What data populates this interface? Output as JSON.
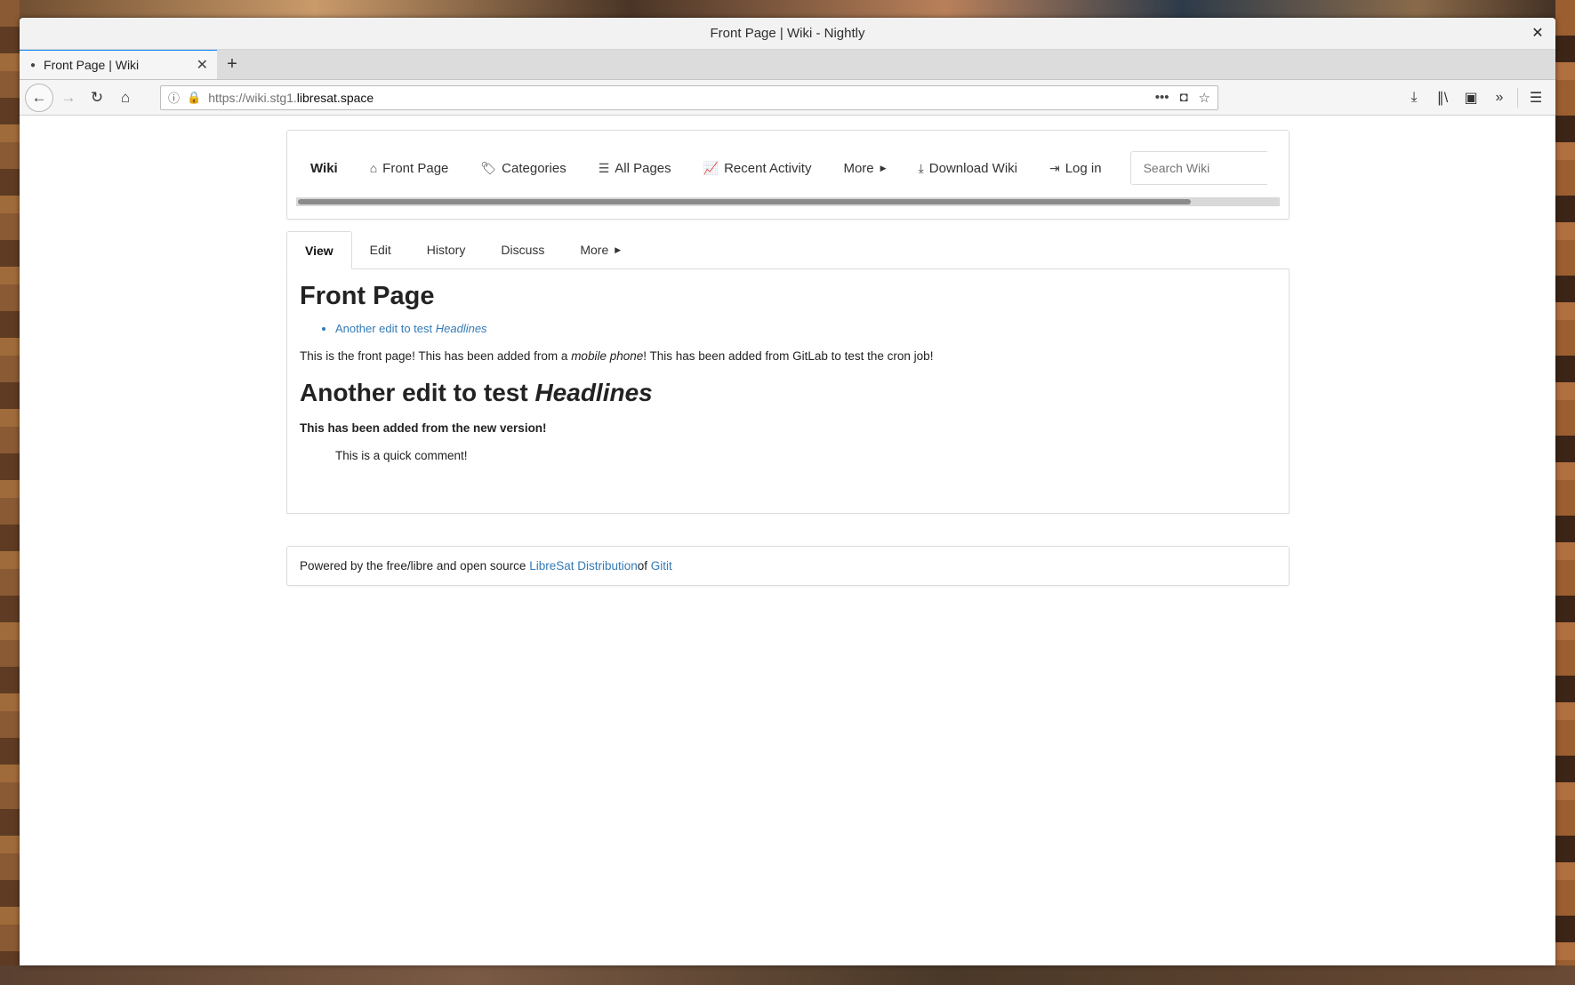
{
  "window": {
    "title": "Front Page | Wiki - Nightly",
    "close_glyph": "✕"
  },
  "tabbar": {
    "tab_label": "Front Page | Wiki",
    "tab_close": "✕",
    "new_tab": "+"
  },
  "navbar": {
    "back": "←",
    "forward": "→",
    "reload": "↻",
    "home": "⌂",
    "url_prefix": "https://wiki.stg1.",
    "url_domain": "libresat.space",
    "page_actions": "•••",
    "icons": [
      "info-icon",
      "lock-icon",
      "page-actions-icon",
      "pocket-icon",
      "bookmark-star-icon",
      "downloads-icon",
      "library-icon",
      "sidebar-icon",
      "overflow-icon",
      "menu-icon"
    ]
  },
  "wiki_nav": {
    "brand": "Wiki",
    "items": [
      {
        "label": "Front Page",
        "icon": "⌂"
      },
      {
        "label": "Categories",
        "icon": "🏷"
      },
      {
        "label": "All Pages",
        "icon": "☰"
      },
      {
        "label": "Recent Activity",
        "icon": "📈"
      },
      {
        "label": "More",
        "icon": ""
      },
      {
        "label": "Download Wiki",
        "icon": "⤓"
      },
      {
        "label": "Log in",
        "icon": "⇥"
      }
    ],
    "search_placeholder": "Search Wiki",
    "caret": "▶"
  },
  "page_tabs": [
    "View",
    "Edit",
    "History",
    "Discuss",
    "More"
  ],
  "article": {
    "title": "Front Page",
    "toc_link_text": "Another edit to test ",
    "toc_link_em": "Headlines",
    "intro_1": "This is the front page! This has been added from a ",
    "intro_em": "mobile phone",
    "intro_2": "! This has been added from GitLab to test the cron job!",
    "h2_text": "Another edit to test ",
    "h2_em": "Headlines",
    "bold_line": "This has been added from the new version!",
    "quote": "This is a quick comment!"
  },
  "footer": {
    "prefix": "Powered by the free/libre and open source ",
    "link1": "LibreSat Distribution",
    "middle": " of ",
    "link2": "Gitit"
  }
}
